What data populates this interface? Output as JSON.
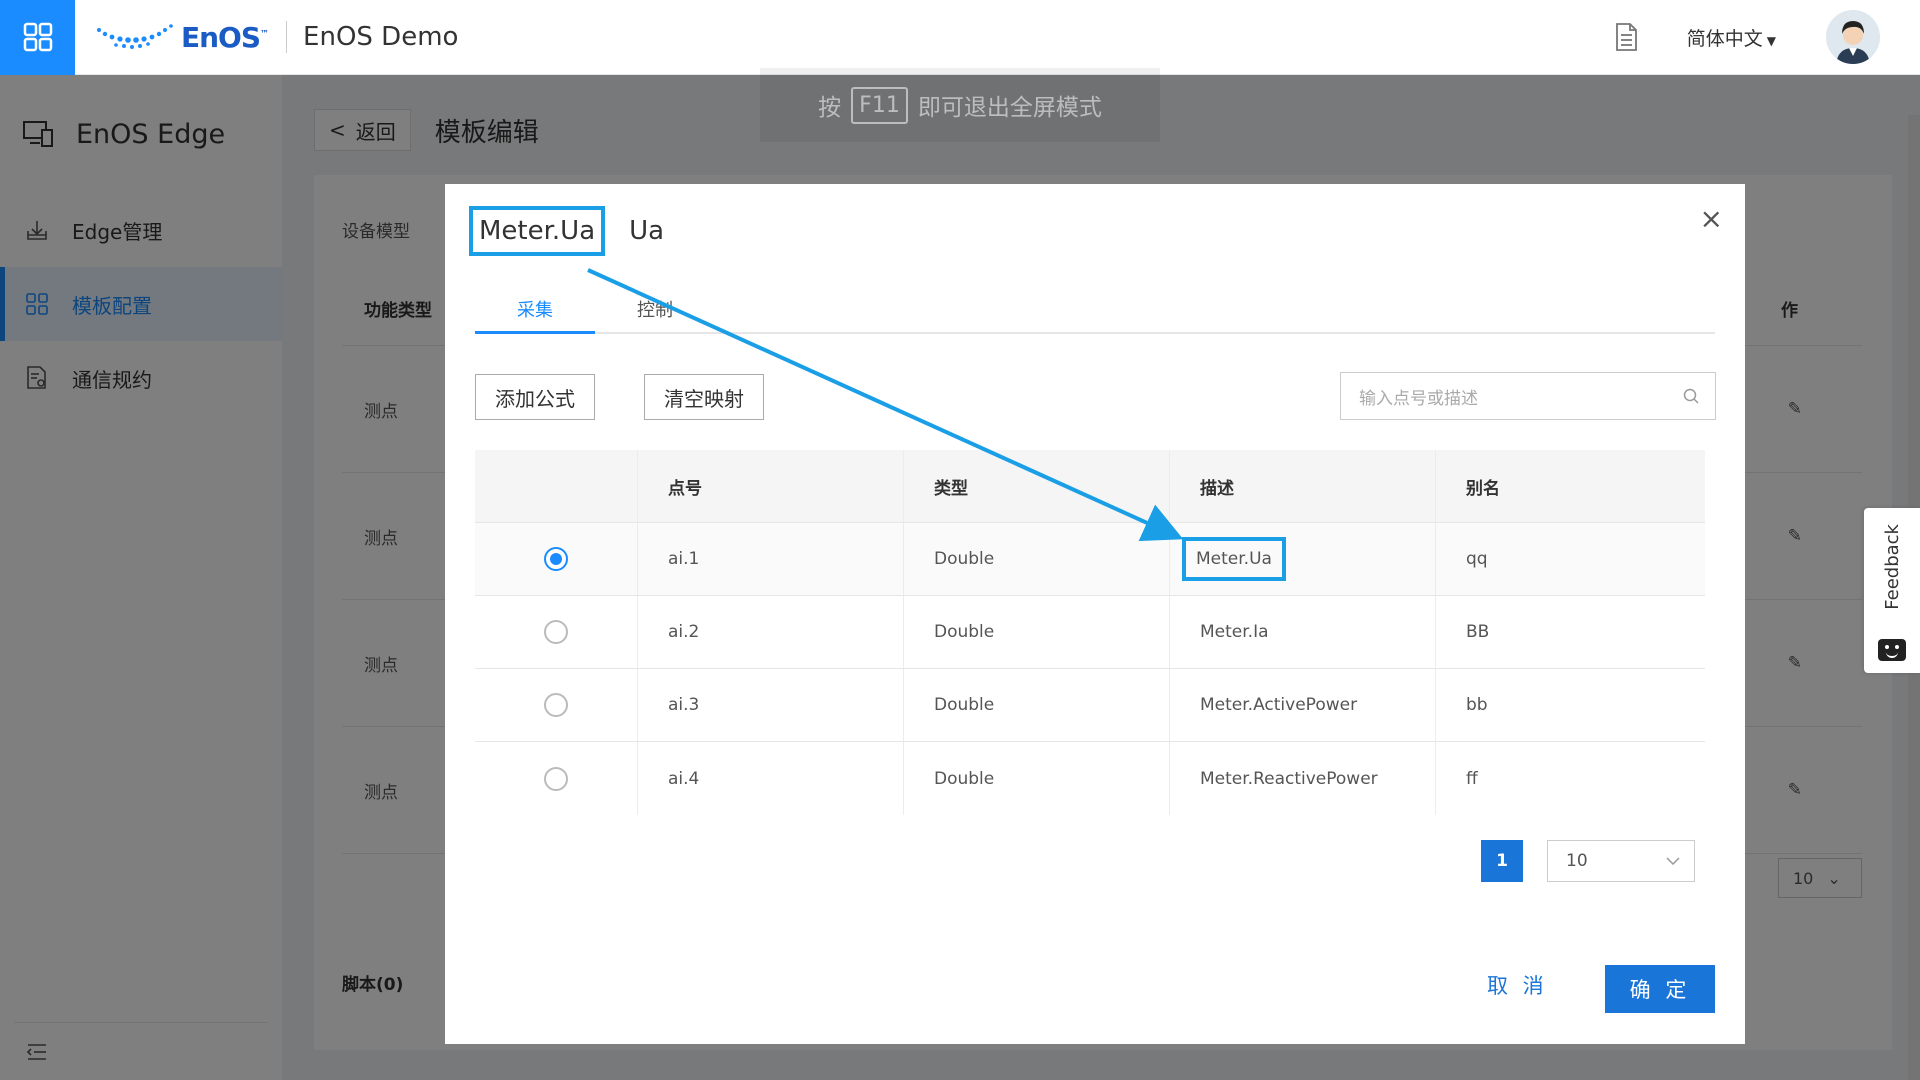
{
  "header": {
    "logo_text": "EnOS",
    "logo_tm": "™",
    "app_title": "EnOS Demo",
    "language": "简体中文"
  },
  "sidebar": {
    "title": "EnOS Edge",
    "items": [
      {
        "label": "Edge管理",
        "icon": "download-box-icon",
        "active": false
      },
      {
        "label": "模板配置",
        "icon": "grid-icon",
        "active": true
      },
      {
        "label": "通信规约",
        "icon": "document-gear-icon",
        "active": false
      }
    ]
  },
  "main": {
    "back_label": "返回",
    "page_title": "模板编辑",
    "device_model_label": "设备模型",
    "column_function_type": "功能类型",
    "column_action": "作",
    "rows": [
      "测点",
      "测点",
      "测点",
      "测点"
    ],
    "page_size": "10",
    "script_label": "脚本(0)"
  },
  "fullscreen_tip": {
    "prefix": "按",
    "key": "F11",
    "suffix": "即可退出全屏模式"
  },
  "feedback": {
    "label": "Feedback"
  },
  "modal": {
    "title": "Meter.Ua",
    "subtitle": "Ua",
    "tabs": [
      {
        "label": "采集",
        "active": true
      },
      {
        "label": "控制",
        "active": false
      }
    ],
    "add_formula": "添加公式",
    "clear_mapping": "清空映射",
    "search_placeholder": "输入点号或描述",
    "columns": [
      "点号",
      "类型",
      "描述",
      "别名"
    ],
    "rows": [
      {
        "point": "ai.1",
        "type": "Double",
        "desc": "Meter.Ua",
        "alias": "qq",
        "selected": true
      },
      {
        "point": "ai.2",
        "type": "Double",
        "desc": "Meter.Ia",
        "alias": "BB",
        "selected": false
      },
      {
        "point": "ai.3",
        "type": "Double",
        "desc": "Meter.ActivePower",
        "alias": "bb",
        "selected": false
      },
      {
        "point": "ai.4",
        "type": "Double",
        "desc": "Meter.ReactivePower",
        "alias": "ff",
        "selected": false
      }
    ],
    "current_page": "1",
    "page_size": "10",
    "cancel": "取 消",
    "ok": "确 定"
  },
  "colors": {
    "primary": "#1a8cff",
    "annotation": "#1a9fe6",
    "button_blue": "#1a75d8"
  }
}
